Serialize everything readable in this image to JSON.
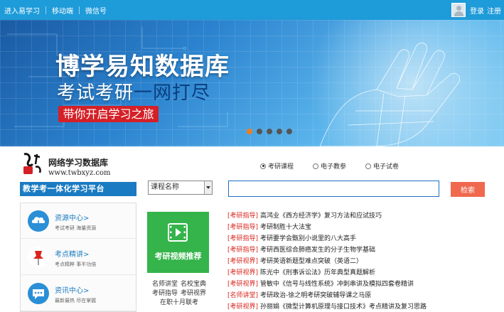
{
  "topbar": {
    "nav": [
      "进入易学习",
      "移动端",
      "微信号"
    ],
    "login": "登录",
    "register": "注册"
  },
  "banner": {
    "title": "博学易知数据库",
    "subtitle_a": "考试考研",
    "subtitle_b": "一网打尽",
    "pill": "带你开启学习之旅",
    "dots_total": 5,
    "dots_active": 1
  },
  "logo": {
    "name": "网络学习数据库",
    "url": "www.twbxyz.com"
  },
  "search": {
    "radios": [
      {
        "label": "考研课程",
        "selected": true
      },
      {
        "label": "电子教参",
        "selected": false
      },
      {
        "label": "电子试卷",
        "selected": false
      }
    ],
    "select_value": "课程名称",
    "input_value": "",
    "button": "检索"
  },
  "slogan": "教学考一体化学习平台",
  "sidebar": {
    "items": [
      {
        "title": "资源中心>",
        "sub": "考试考研  海量资源",
        "icon": "cloud-download-icon"
      },
      {
        "title": "考点精讲>",
        "sub": "考点精粹  事半功倍",
        "icon": "pushpin-icon"
      },
      {
        "title": "资讯中心>",
        "sub": "最新最热  尽在掌握",
        "icon": "chat-bubble-icon"
      }
    ]
  },
  "video": {
    "label": "考研视频推荐",
    "links": [
      [
        "名师讲堂",
        "名校宝典"
      ],
      [
        "考研指导",
        "考研视界"
      ],
      [
        "在职十月联考"
      ]
    ]
  },
  "courses": [
    {
      "cat": "[考研指导]",
      "title": "高鸿业《西方经济学》复习方法和应试技巧"
    },
    {
      "cat": "[考研指导]",
      "title": "考研制胜十大法宝"
    },
    {
      "cat": "[考研指导]",
      "title": "考研要学会甄别小说里的八大高手"
    },
    {
      "cat": "[考研指导]",
      "title": "考研西医综合肺癌发生的分子生物学基础"
    },
    {
      "cat": "[考研视界]",
      "title": "考研英语新题型难点突破（英语二）"
    },
    {
      "cat": "[考研视界]",
      "title": "陈光中《刑事诉讼法》历年典型真题解析"
    },
    {
      "cat": "[考研视界]",
      "title": "管敏中《信号与线性系统》冲刺串讲及模拟四套卷精讲"
    },
    {
      "cat": "[名师讲堂]",
      "title": "考研政治-徐之明考研突破辅导课之马原"
    },
    {
      "cat": "[考研视界]",
      "title": "孙丽娟《微型计算机原理与接口技术》考点精讲及复习思路"
    }
  ],
  "colors": {
    "topbar": "#1e9bd9",
    "accent_blue": "#1a7bc2",
    "search_button": "#f0694f",
    "video_green": "#34b44a",
    "category_red": "#d9251c",
    "dot_active": "#f07d1f"
  }
}
